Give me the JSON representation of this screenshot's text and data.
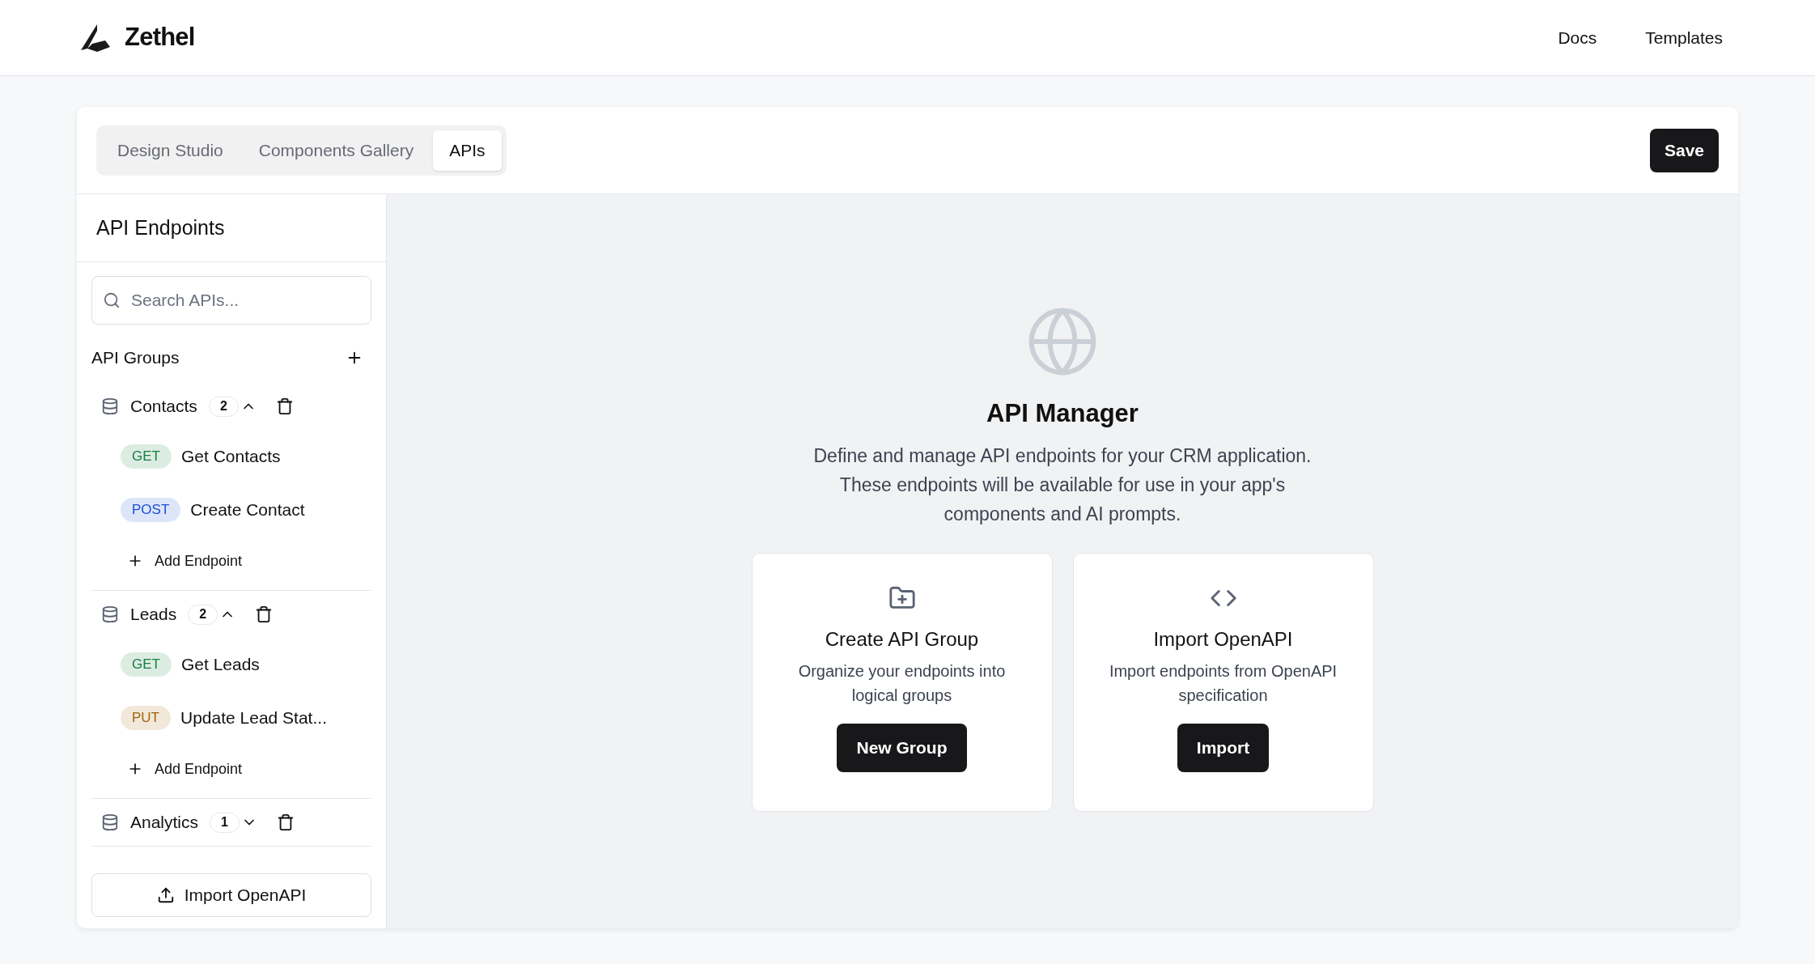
{
  "header": {
    "brand": "Zethel",
    "nav": [
      "Docs",
      "Templates"
    ]
  },
  "tabs": [
    {
      "label": "Design Studio",
      "selected": false
    },
    {
      "label": "Components Gallery",
      "selected": false
    },
    {
      "label": "APIs",
      "selected": true
    }
  ],
  "save_button": "Save",
  "sidebar": {
    "title": "API Endpoints",
    "search": {
      "placeholder": "Search APIs..."
    },
    "groups_label": "API Groups",
    "groups": [
      {
        "name": "Contacts",
        "count": "2",
        "expanded": true,
        "endpoints": [
          {
            "method": "GET",
            "color": "#15803d",
            "name": "Get Contacts"
          },
          {
            "method": "POST",
            "color": "#1d4ed8",
            "name": "Create Contact"
          }
        ],
        "add_label": "Add Endpoint"
      },
      {
        "name": "Leads",
        "count": "2",
        "expanded": true,
        "endpoints": [
          {
            "method": "GET",
            "color": "#15803d",
            "name": "Get Leads"
          },
          {
            "method": "PUT",
            "color": "#a16207",
            "name": "Update Lead Stat..."
          }
        ],
        "add_label": "Add Endpoint"
      },
      {
        "name": "Analytics",
        "count": "1",
        "expanded": false
      }
    ],
    "import_button": "Import OpenAPI"
  },
  "main": {
    "title": "API Manager",
    "description": "Define and manage API endpoints for your CRM application. These endpoints will be available for use in your app's components and AI prompts.",
    "cards": [
      {
        "kind": "folder",
        "title": "Create API Group",
        "description": "Organize your endpoints into logical groups",
        "button": "New Group"
      },
      {
        "kind": "code",
        "title": "Import OpenAPI",
        "description": "Import endpoints from OpenAPI specification",
        "button": "Import"
      }
    ]
  }
}
